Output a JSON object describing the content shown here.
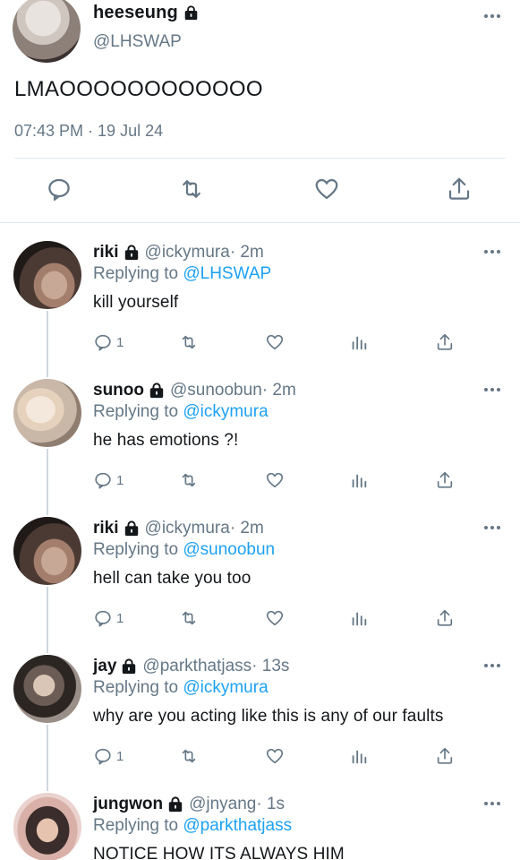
{
  "main_tweet": {
    "display_name": "heeseung",
    "handle": "@LHSWAP",
    "text": "LMAOOOOOOOOOOOO",
    "timestamp": "07:43 PM · 19 Jul 24"
  },
  "icons": {
    "reply": "speech-bubble-icon",
    "retweet": "retweet-icon",
    "like": "heart-icon",
    "analytics": "bar-chart-icon",
    "share": "share-upload-icon",
    "lock": "lock-icon",
    "more": "ellipsis-icon"
  },
  "colors": {
    "link": "#1da1f2",
    "secondary_text": "#657786",
    "divider": "#e1e8ed"
  },
  "replies": [
    {
      "display_name": "riki",
      "handle": "@ickymura",
      "time": " · 2m",
      "replying_prefix": "Replying to ",
      "replying_to": "@LHSWAP",
      "text": "kill yourself",
      "reply_count": "1"
    },
    {
      "display_name": "sunoo",
      "handle": "@sunoobun",
      "time": " · 2m",
      "replying_prefix": "Replying to ",
      "replying_to": "@ickymura",
      "text": "he has emotions ?!",
      "reply_count": "1"
    },
    {
      "display_name": "riki",
      "handle": "@ickymura",
      "time": " · 2m",
      "replying_prefix": "Replying to ",
      "replying_to": "@sunoobun",
      "text": "hell can take you too",
      "reply_count": "1"
    },
    {
      "display_name": "jay",
      "handle": "@parkthatjass",
      "time": " · 13s",
      "replying_prefix": "Replying to ",
      "replying_to": "@ickymura",
      "text": "why are you acting like this is any of our faults",
      "reply_count": "1"
    },
    {
      "display_name": "jungwon",
      "handle": "@jnyang",
      "time": " · 1s",
      "replying_prefix": "Replying to ",
      "replying_to": "@parkthatjass",
      "text": "NOTICE HOW ITS ALWAYS HIM",
      "reply_count": ""
    }
  ]
}
